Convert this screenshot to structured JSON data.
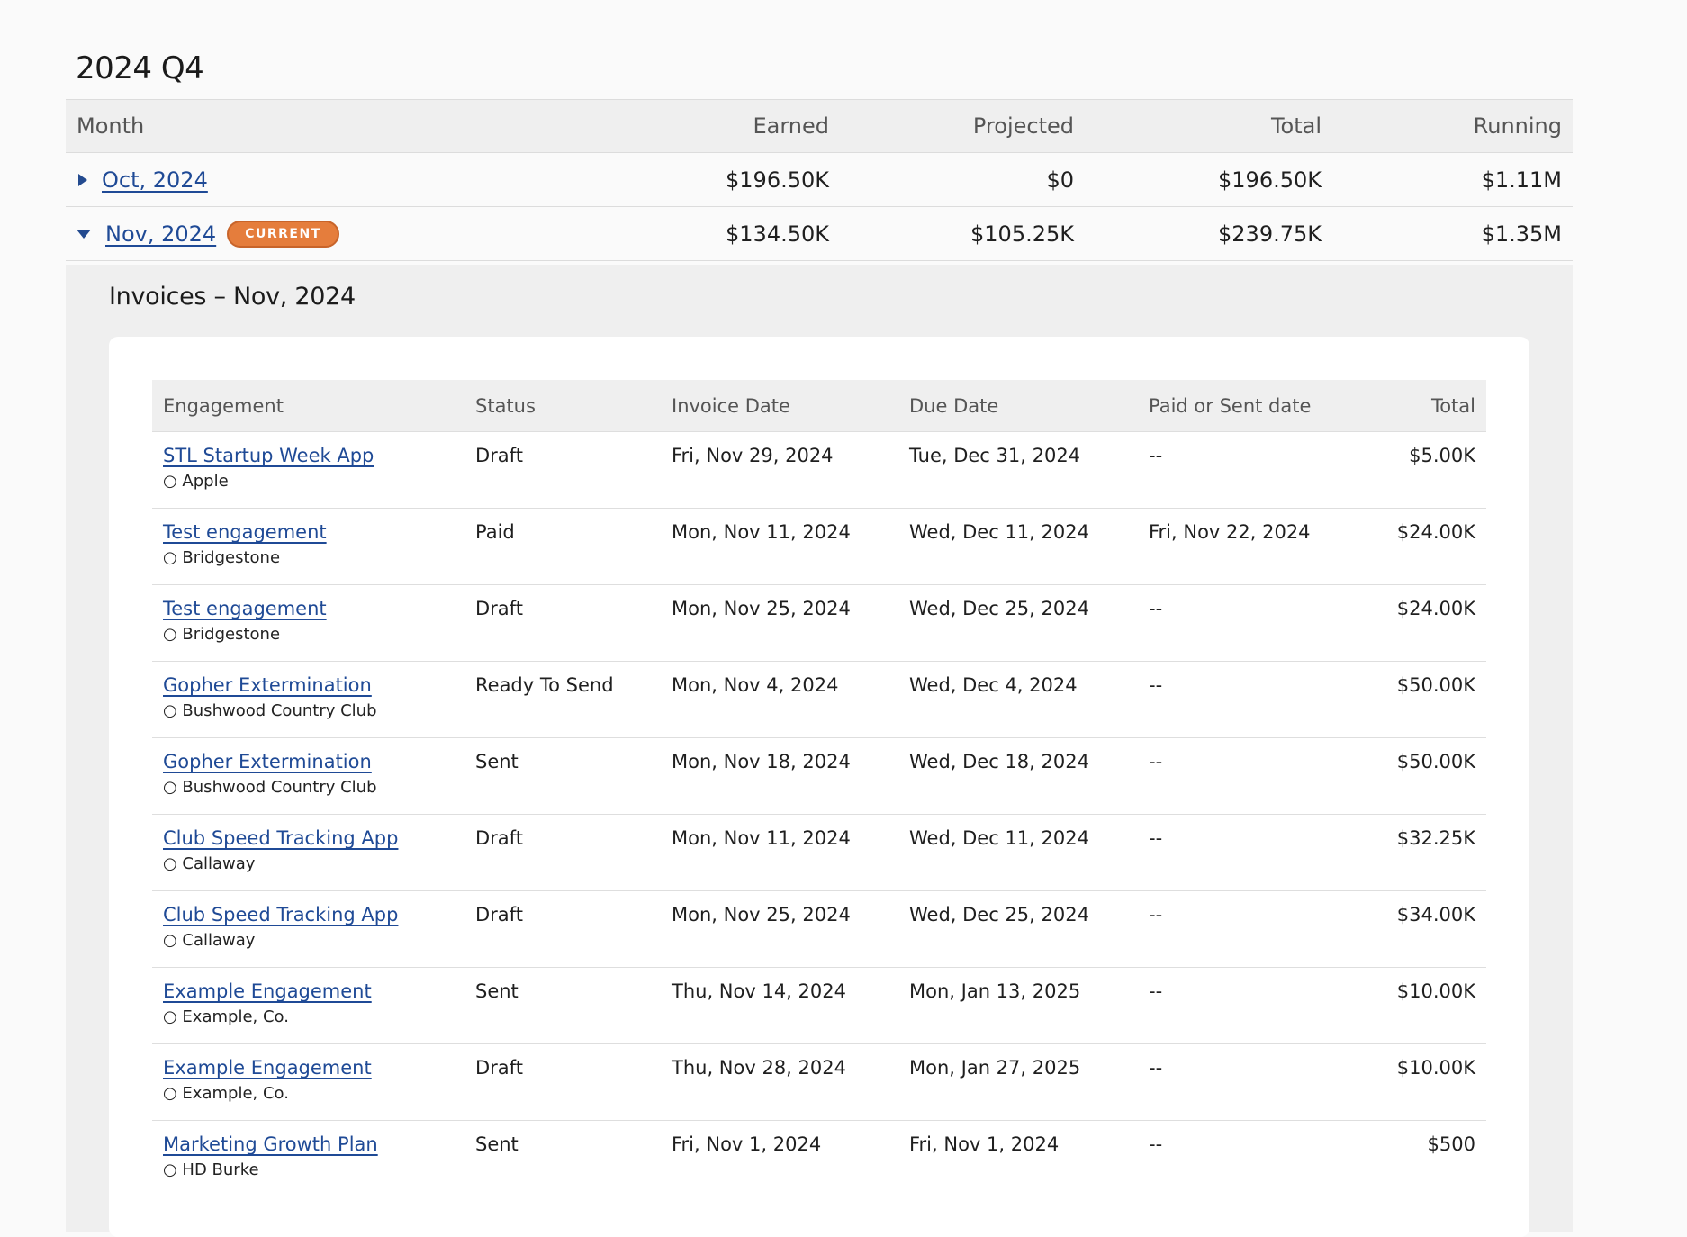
{
  "quarter": {
    "title": "2024 Q4"
  },
  "summary": {
    "headers": {
      "month": "Month",
      "earned": "Earned",
      "projected": "Projected",
      "total": "Total",
      "running": "Running"
    },
    "rows": [
      {
        "month": "Oct, 2024",
        "expanded": false,
        "badge": "",
        "earned": "$196.50K",
        "projected": "$0",
        "total": "$196.50K",
        "running": "$1.11M"
      },
      {
        "month": "Nov, 2024",
        "expanded": true,
        "badge": "CURRENT",
        "earned": "$134.50K",
        "projected": "$105.25K",
        "total": "$239.75K",
        "running": "$1.35M"
      }
    ]
  },
  "invoices": {
    "title": "Invoices – Nov, 2024",
    "headers": {
      "engagement": "Engagement",
      "status": "Status",
      "invoice_date": "Invoice Date",
      "due_date": "Due Date",
      "paid_sent": "Paid or Sent date",
      "total": "Total"
    },
    "rows": [
      {
        "engagement": "STL Startup Week App",
        "client": "○ Apple",
        "status": "Draft",
        "invoice_date": "Fri, Nov 29, 2024",
        "due_date": "Tue, Dec 31, 2024",
        "paid_sent": "--",
        "total": "$5.00K"
      },
      {
        "engagement": "Test engagement",
        "client": "○ Bridgestone",
        "status": "Paid",
        "invoice_date": "Mon, Nov 11, 2024",
        "due_date": "Wed, Dec 11, 2024",
        "paid_sent": "Fri, Nov 22, 2024",
        "total": "$24.00K"
      },
      {
        "engagement": "Test engagement",
        "client": "○ Bridgestone",
        "status": "Draft",
        "invoice_date": "Mon, Nov 25, 2024",
        "due_date": "Wed, Dec 25, 2024",
        "paid_sent": "--",
        "total": "$24.00K"
      },
      {
        "engagement": "Gopher Extermination",
        "client": "○ Bushwood Country Club",
        "status": "Ready To Send",
        "invoice_date": "Mon, Nov 4, 2024",
        "due_date": "Wed, Dec 4, 2024",
        "paid_sent": "--",
        "total": "$50.00K"
      },
      {
        "engagement": "Gopher Extermination",
        "client": "○ Bushwood Country Club",
        "status": "Sent",
        "invoice_date": "Mon, Nov 18, 2024",
        "due_date": "Wed, Dec 18, 2024",
        "paid_sent": "--",
        "total": "$50.00K"
      },
      {
        "engagement": "Club Speed Tracking App",
        "client": "○ Callaway",
        "status": "Draft",
        "invoice_date": "Mon, Nov 11, 2024",
        "due_date": "Wed, Dec 11, 2024",
        "paid_sent": "--",
        "total": "$32.25K"
      },
      {
        "engagement": "Club Speed Tracking App",
        "client": "○ Callaway",
        "status": "Draft",
        "invoice_date": "Mon, Nov 25, 2024",
        "due_date": "Wed, Dec 25, 2024",
        "paid_sent": "--",
        "total": "$34.00K"
      },
      {
        "engagement": "Example Engagement",
        "client": "○ Example, Co.",
        "status": "Sent",
        "invoice_date": "Thu, Nov 14, 2024",
        "due_date": "Mon, Jan 13, 2025",
        "paid_sent": "--",
        "total": "$10.00K"
      },
      {
        "engagement": "Example Engagement",
        "client": "○ Example, Co.",
        "status": "Draft",
        "invoice_date": "Thu, Nov 28, 2024",
        "due_date": "Mon, Jan 27, 2025",
        "paid_sent": "--",
        "total": "$10.00K"
      },
      {
        "engagement": "Marketing Growth Plan",
        "client": "○ HD Burke",
        "status": "Sent",
        "invoice_date": "Fri, Nov 1, 2024",
        "due_date": "Fri, Nov 1, 2024",
        "paid_sent": "--",
        "total": "$500"
      }
    ]
  },
  "colors": {
    "link": "#1f4a96",
    "badge": "#e57d3c",
    "header_bg": "#efefef",
    "page_bg": "#fafafa"
  },
  "icons": {
    "collapsed": "caret-right-icon",
    "expanded": "caret-down-icon"
  }
}
